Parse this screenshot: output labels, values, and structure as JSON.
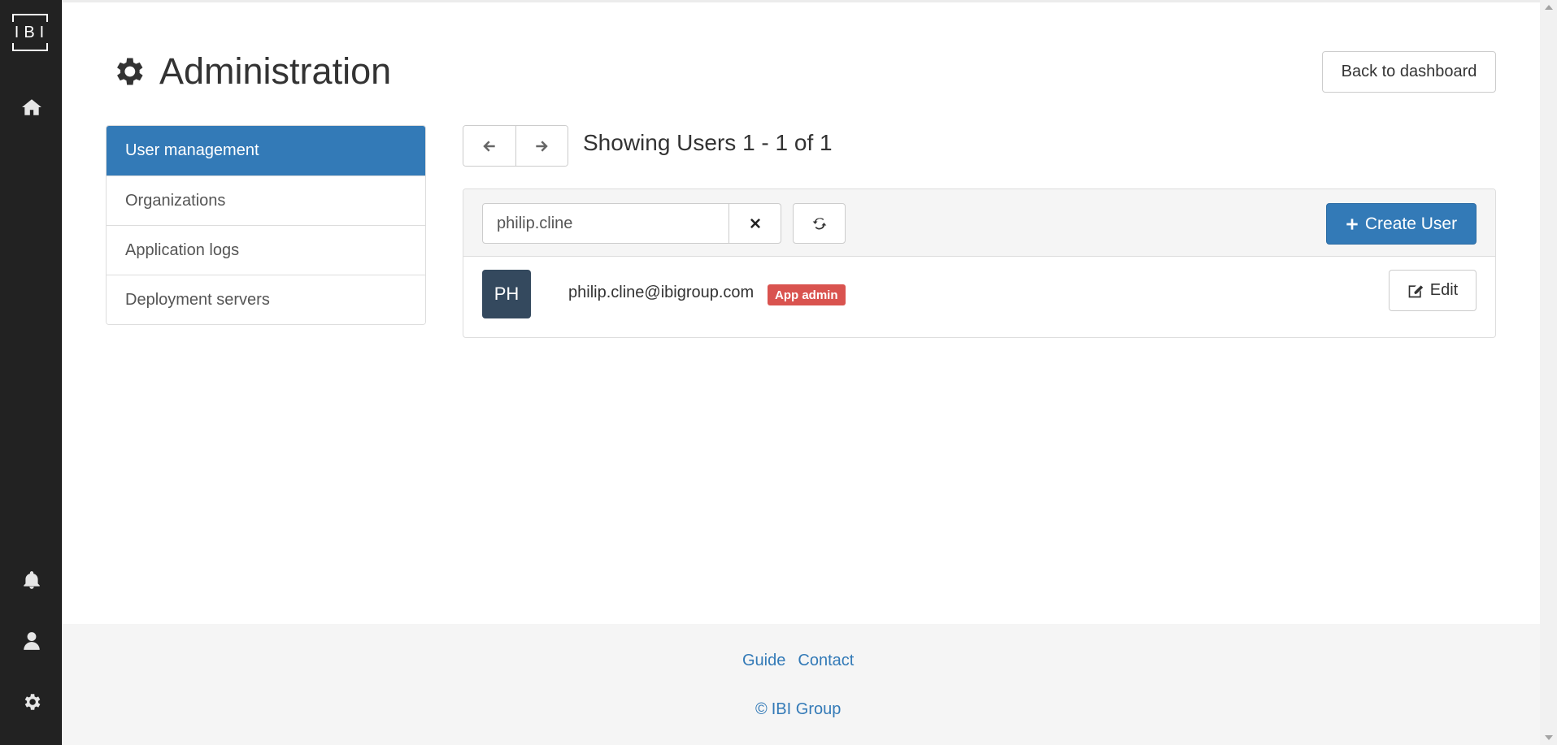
{
  "rail": {
    "logo_text": "IBI",
    "icons": [
      "home-icon",
      "bell-icon",
      "user-icon",
      "gear-icon"
    ]
  },
  "header": {
    "title": "Administration",
    "title_icon": "gear-icon",
    "back_button": "Back to dashboard"
  },
  "sidebar": {
    "items": [
      {
        "label": "User management",
        "active": true
      },
      {
        "label": "Organizations",
        "active": false
      },
      {
        "label": "Application logs",
        "active": false
      },
      {
        "label": "Deployment servers",
        "active": false
      }
    ]
  },
  "pager": {
    "prev_icon": "arrow-left-icon",
    "next_icon": "arrow-right-icon",
    "summary": "Showing Users 1 - 1 of 1"
  },
  "toolbar": {
    "search_value": "philip.cline",
    "clear_icon": "close-icon",
    "refresh_icon": "refresh-icon",
    "create_label": "Create User"
  },
  "users": [
    {
      "initials": "PH",
      "email": "philip.cline@ibigroup.com",
      "badge": "App admin",
      "edit_label": "Edit"
    }
  ],
  "footer": {
    "links": [
      "Guide",
      "Contact"
    ],
    "copyright_symbol": "©",
    "copyright_text": "IBI Group"
  },
  "colors": {
    "primary": "#337ab7",
    "danger": "#d9534f",
    "rail": "#222222",
    "avatar": "#34495e"
  }
}
